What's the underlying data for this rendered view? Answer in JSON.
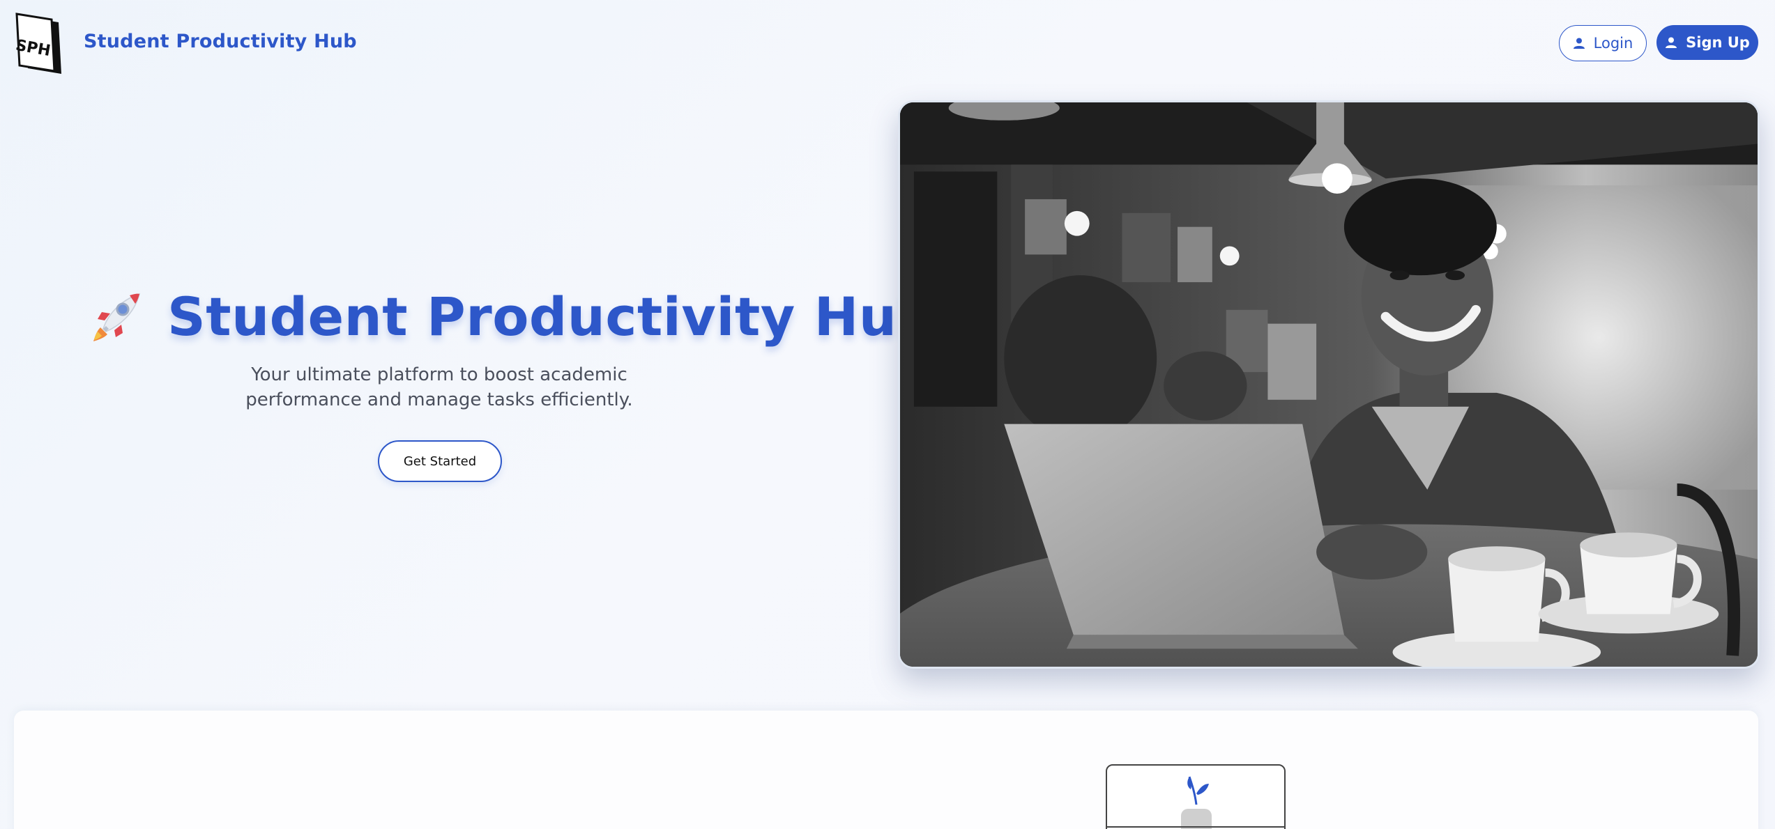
{
  "header": {
    "logo_text": "SPH",
    "brand_name": "Student Productivity Hub",
    "login_label": "Login",
    "signup_label": "Sign Up",
    "login_icon": "user-icon",
    "signup_icon": "user-icon"
  },
  "hero": {
    "title": "Student Productivity Hub",
    "title_icon": "rocket-icon",
    "subtitle": "Your ultimate platform to boost academic performance and manage tasks efficiently.",
    "cta_label": "Get Started",
    "image_description_icon": "student-laptop-photo"
  },
  "colors": {
    "accent": "#2d57c9",
    "background": "#f2f6fc",
    "text_muted": "#4a4f5c"
  }
}
